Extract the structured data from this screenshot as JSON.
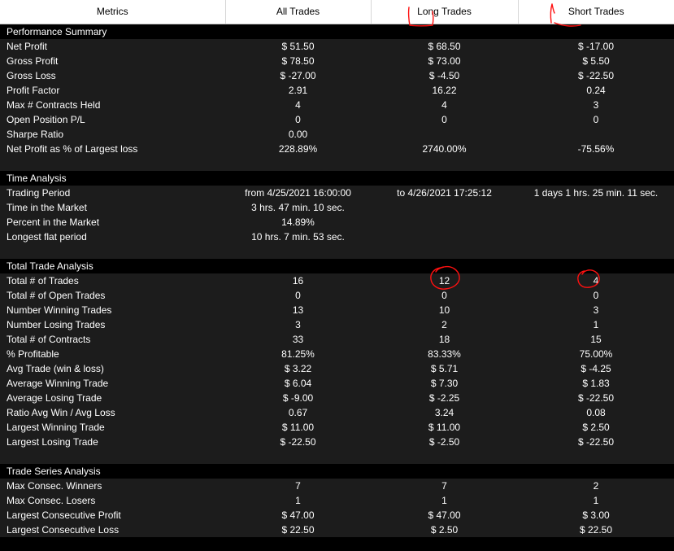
{
  "header": {
    "columns": [
      "Metrics",
      "All Trades",
      "Long Trades",
      "Short Trades"
    ]
  },
  "sections": [
    {
      "title": "Performance Summary",
      "rows": [
        {
          "label": "Net Profit",
          "values": [
            "$ 51.50",
            "$ 68.50",
            "$ -17.00"
          ]
        },
        {
          "label": "Gross Profit",
          "values": [
            "$ 78.50",
            "$ 73.00",
            "$ 5.50"
          ]
        },
        {
          "label": "Gross Loss",
          "values": [
            "$ -27.00",
            "$ -4.50",
            "$ -22.50"
          ]
        },
        {
          "label": "Profit Factor",
          "values": [
            "2.91",
            "16.22",
            "0.24"
          ]
        },
        {
          "label": "Max # Contracts Held",
          "values": [
            "4",
            "4",
            "3"
          ]
        },
        {
          "label": "Open Position P/L",
          "values": [
            "0",
            "0",
            "0"
          ]
        },
        {
          "label": "Sharpe Ratio",
          "values": [
            "0.00",
            "",
            ""
          ]
        },
        {
          "label": "Net Profit as % of Largest loss",
          "values": [
            "228.89%",
            "2740.00%",
            "-75.56%"
          ]
        }
      ]
    },
    {
      "title": "Time Analysis",
      "rows": [
        {
          "label": "Trading Period",
          "values": [
            "from 4/25/2021 16:00:00",
            "to 4/26/2021 17:25:12",
            "1 days 1 hrs. 25 min. 11 sec."
          ]
        },
        {
          "label": "Time in the Market",
          "values": [
            "3 hrs. 47 min. 10 sec.",
            "",
            ""
          ]
        },
        {
          "label": "Percent in the Market",
          "values": [
            "14.89%",
            "",
            ""
          ]
        },
        {
          "label": "Longest flat period",
          "values": [
            "10 hrs. 7 min. 53 sec.",
            "",
            ""
          ]
        }
      ]
    },
    {
      "title": "Total Trade Analysis",
      "rows": [
        {
          "label": "Total # of Trades",
          "values": [
            "16",
            "12",
            "4"
          ]
        },
        {
          "label": "Total # of Open Trades",
          "values": [
            "0",
            "0",
            "0"
          ]
        },
        {
          "label": "Number Winning Trades",
          "values": [
            "13",
            "10",
            "3"
          ]
        },
        {
          "label": "Number Losing Trades",
          "values": [
            "3",
            "2",
            "1"
          ]
        },
        {
          "label": "Total # of Contracts",
          "values": [
            "33",
            "18",
            "15"
          ]
        },
        {
          "label": "% Profitable",
          "values": [
            "81.25%",
            "83.33%",
            "75.00%"
          ]
        },
        {
          "label": "Avg Trade (win & loss)",
          "values": [
            "$ 3.22",
            "$ 5.71",
            "$ -4.25"
          ]
        },
        {
          "label": "Average Winning Trade",
          "values": [
            "$ 6.04",
            "$ 7.30",
            "$ 1.83"
          ]
        },
        {
          "label": "Average Losing Trade",
          "values": [
            "$ -9.00",
            "$ -2.25",
            "$ -22.50"
          ]
        },
        {
          "label": "Ratio Avg Win / Avg Loss",
          "values": [
            "0.67",
            "3.24",
            "0.08"
          ]
        },
        {
          "label": "Largest Winning Trade",
          "values": [
            "$ 11.00",
            "$ 11.00",
            "$ 2.50"
          ]
        },
        {
          "label": "Largest Losing Trade",
          "values": [
            "$ -22.50",
            "$ -2.50",
            "$ -22.50"
          ]
        }
      ]
    },
    {
      "title": "Trade Series Analysis",
      "rows": [
        {
          "label": "Max Consec. Winners",
          "values": [
            "7",
            "7",
            "2"
          ]
        },
        {
          "label": "Max Consec. Losers",
          "values": [
            "1",
            "1",
            "1"
          ]
        },
        {
          "label": "Largest Consecutive Profit",
          "values": [
            "$ 47.00",
            "$ 47.00",
            "$ 3.00"
          ]
        },
        {
          "label": "Largest Consecutive Loss",
          "values": [
            "$ 22.50",
            "$ 2.50",
            "$ 22.50"
          ]
        }
      ]
    }
  ],
  "colors": {
    "header_bg": "#ffffff",
    "header_text": "#000000",
    "section_bg": "#000000",
    "row_bg": "#1c1c1c",
    "text": "#ffffff",
    "annotation": "#ff1010"
  }
}
